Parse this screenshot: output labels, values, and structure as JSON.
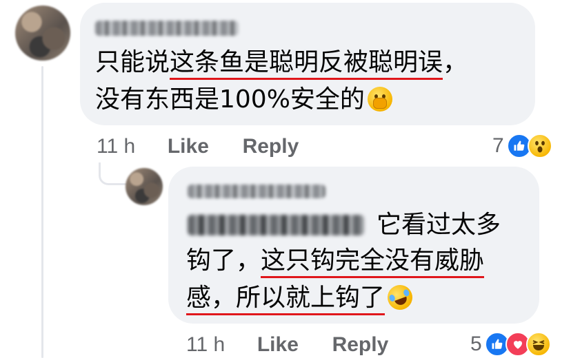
{
  "comment": {
    "line1_prefix": "只能说",
    "line1_underlined": "这条鱼是聪明反被聪明误",
    "line1_suffix": "，",
    "line2": "没有东西是100%安全的",
    "emoji": "shushing-face-emoji",
    "time": "11 h",
    "like_label": "Like",
    "reply_label": "Reply",
    "reaction_count": "7",
    "reactions": [
      "like-icon",
      "wow-icon"
    ]
  },
  "reply": {
    "line1_text": "它看过太多",
    "line2_prefix": "钩了，",
    "line2_underlined": "这只钩完全没有威胁",
    "line3_underlined": "感，所以就上钩了",
    "emoji": "rofl-emoji",
    "time": "11 h",
    "like_label": "Like",
    "reply_label": "Reply",
    "reaction_count": "5",
    "reactions": [
      "like-icon",
      "love-icon",
      "haha-icon"
    ]
  },
  "colors": {
    "bubble": "#f0f2f5",
    "meta_text": "#65676b",
    "underline": "#e0161b",
    "like_blue": "#1877f2",
    "love_red": "#f33e58"
  }
}
